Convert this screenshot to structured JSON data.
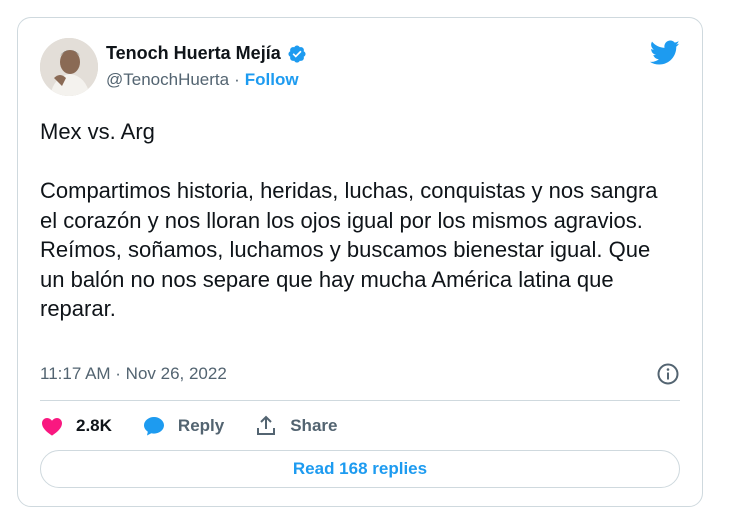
{
  "tweet": {
    "author": {
      "name": "Tenoch Huerta Mejía",
      "handle": "@TenochHuerta",
      "separator": "·",
      "follow_label": "Follow"
    },
    "text": "Mex vs. Arg\n\nCompartimos historia, heridas, luchas, conquistas y nos sangra el corazón y nos lloran los ojos igual por los mismos agravios.\nReímos, soñamos, luchamos y buscamos bienestar igual. Que un balón no nos separe que hay mucha América latina que reparar.",
    "timestamp": "11:17 AM · Nov 26, 2022",
    "actions": {
      "likes": "2.8K",
      "reply_label": "Reply",
      "share_label": "Share"
    },
    "read_replies_label": "Read 168 replies"
  },
  "colors": {
    "accent": "#1d9bf0",
    "like": "#f91880",
    "text": "#0f1419",
    "secondary": "#536471",
    "border": "#cfd9de"
  },
  "icons": {
    "verified": "verified-badge-icon",
    "brand": "twitter-bird-icon",
    "info": "info-icon",
    "like": "heart-icon",
    "reply": "speech-bubble-icon",
    "share": "share-upload-icon"
  }
}
